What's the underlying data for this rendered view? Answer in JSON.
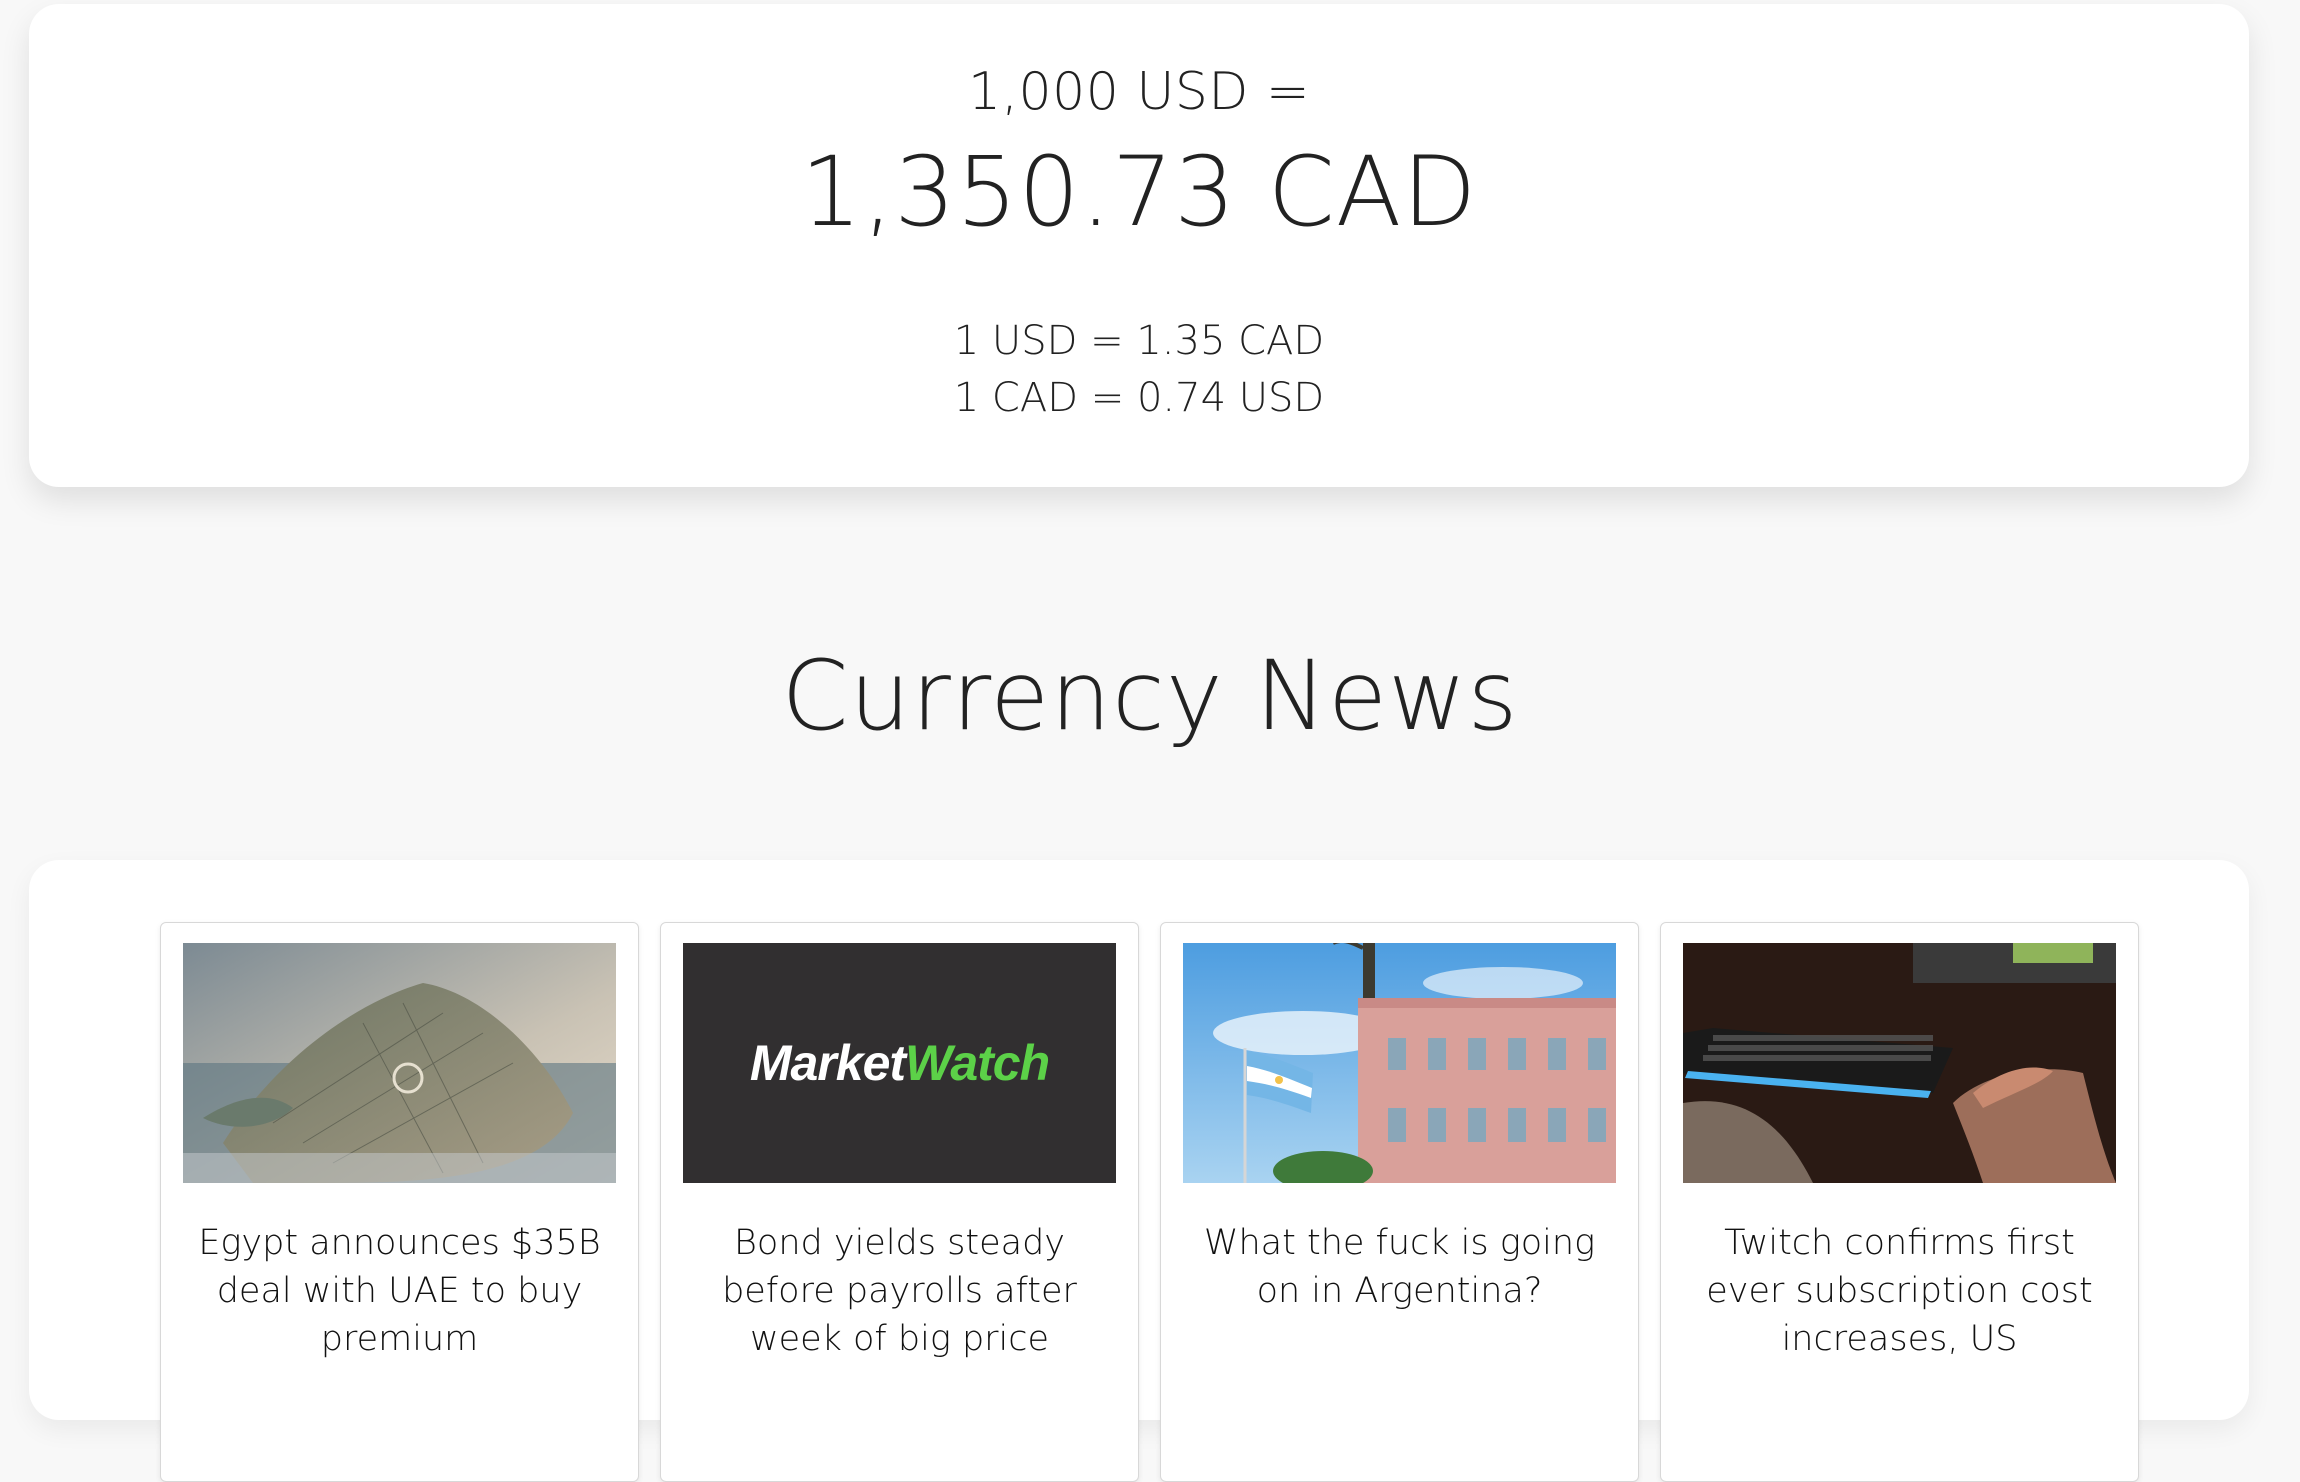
{
  "converter": {
    "amount_line": "1,000 USD =",
    "result_line": "1,350.73 CAD",
    "rate_forward": "1 USD = 1.35 CAD",
    "rate_reverse": "1 CAD = 0.74 USD"
  },
  "news": {
    "title": "Currency News",
    "articles": [
      {
        "headline": "Egypt announces $35B deal with UAE to buy premium",
        "image": "aerial-coastal-city-render"
      },
      {
        "headline": "Bond yields steady before payrolls after week of big price",
        "image": "marketwatch-logo",
        "logo_text_1": "Market",
        "logo_text_2": "Watch"
      },
      {
        "headline": "What the fuck is going on in Argentina?",
        "image": "casa-rosada-argentina-flag"
      },
      {
        "headline": "Twitch confirms first ever subscription cost increases, US",
        "image": "gamer-keyboard-photo"
      }
    ]
  },
  "colors": {
    "page_background": "#f8f8f8",
    "card_background": "#ffffff",
    "marketwatch_green": "#5cd148",
    "marketwatch_bg": "#312f30"
  }
}
